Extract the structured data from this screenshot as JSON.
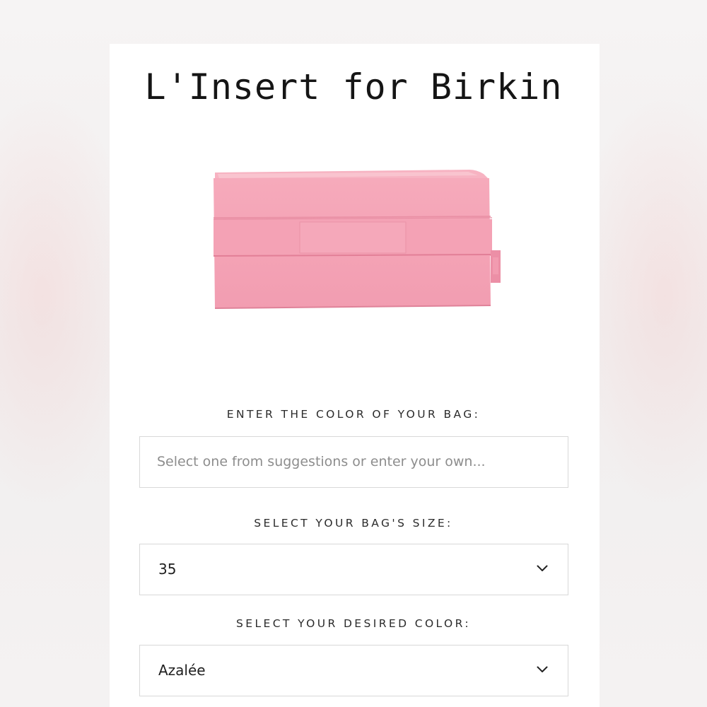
{
  "page": {
    "title": "L'Insert for Birkin"
  },
  "product_image": {
    "icon": "pink-bag-insert-image",
    "color": "#f3a3b5"
  },
  "bag_color": {
    "label": "ENTER THE COLOR OF YOUR BAG:",
    "value": "",
    "placeholder": "Select one from suggestions or enter your own..."
  },
  "bag_size": {
    "label": "SELECT YOUR BAG'S SIZE:",
    "selected": "35",
    "icon": "chevron-down-icon"
  },
  "desired_color": {
    "label": "SELECT YOUR DESIRED COLOR:",
    "selected": "Azalée",
    "icon": "chevron-down-icon"
  }
}
